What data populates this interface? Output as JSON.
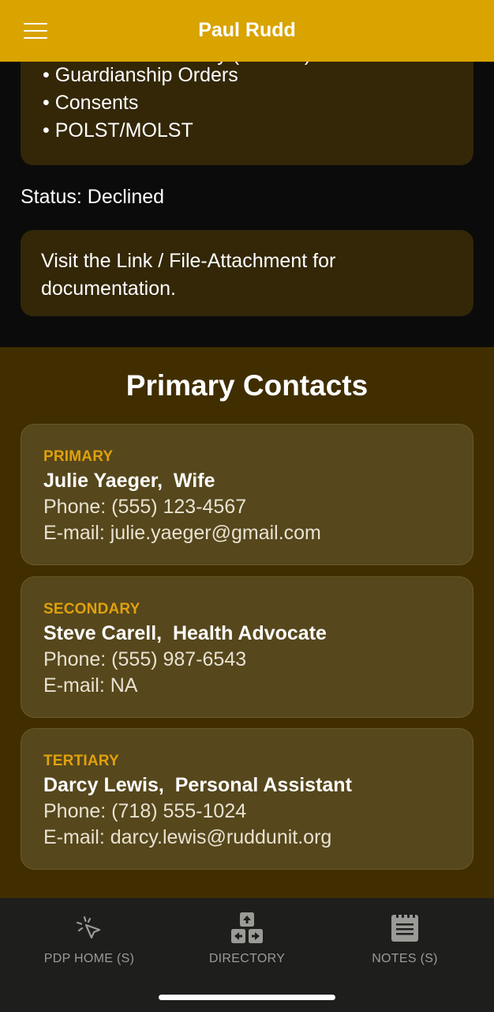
{
  "header": {
    "title": "Paul Rudd",
    "menu_icon": "hamburger-menu-icon"
  },
  "documents": {
    "items": [
      "Guardianship Orders",
      "Consents",
      "POLST/MOLST"
    ],
    "cut_off_line": "Healthcare Proxy (Various)"
  },
  "status": {
    "label": "Status: Declined"
  },
  "visit_note": {
    "text": "Visit the Link / File-Attachment for documentation."
  },
  "contacts": {
    "title": "Primary Contacts",
    "items": [
      {
        "role": "PRIMARY",
        "name": "Julie Yaeger,  Wife",
        "phone": "Phone: (555) 123-4567",
        "email": "E-mail: julie.yaeger@gmail.com"
      },
      {
        "role": "SECONDARY",
        "name": "Steve Carell,  Health Advocate",
        "phone": "Phone: (555) 987-6543",
        "email": "E-mail: NA"
      },
      {
        "role": "TERTIARY",
        "name": "Darcy Lewis,  Personal Assistant",
        "phone": "Phone: (718) 555-1024",
        "email": "E-mail: darcy.lewis@ruddunit.org"
      }
    ]
  },
  "nav": {
    "items": [
      {
        "label": "PDP HOME (S)",
        "icon": "cursor-click-icon"
      },
      {
        "label": "DIRECTORY",
        "icon": "directory-arrows-icon"
      },
      {
        "label": "NOTES (S)",
        "icon": "notepad-icon"
      }
    ]
  },
  "colors": {
    "header": "#d9a300",
    "accent": "#e0a10c",
    "contacts_bg": "#402e00",
    "card_bg": "#56471c",
    "doc_card_bg": "#332708",
    "nav_bg": "#1e1e1c"
  }
}
